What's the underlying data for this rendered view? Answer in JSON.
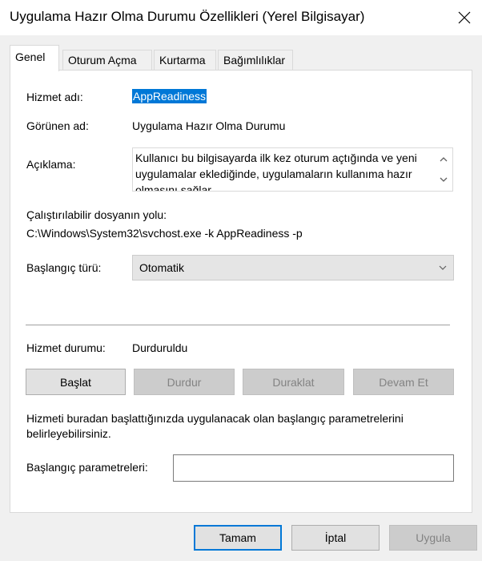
{
  "window": {
    "title": "Uygulama Hazır Olma Durumu Özellikleri (Yerel Bilgisayar)"
  },
  "tabs": [
    {
      "label": "Genel",
      "active": true
    },
    {
      "label": "Oturum Açma",
      "active": false
    },
    {
      "label": "Kurtarma",
      "active": false
    },
    {
      "label": "Bağımlılıklar",
      "active": false
    }
  ],
  "general": {
    "service_name_label": "Hizmet adı:",
    "service_name_value": "AppReadiness",
    "display_name_label": "Görünen ad:",
    "display_name_value": "Uygulama Hazır Olma Durumu",
    "description_label": "Açıklama:",
    "description_value": "Kullanıcı bu bilgisayarda ilk kez oturum açtığında ve yeni uygulamalar eklediğinde, uygulamaların kullanıma hazır olmasını sağlar.",
    "exe_path_label": "Çalıştırılabilir dosyanın yolu:",
    "exe_path_value": "C:\\Windows\\System32\\svchost.exe -k AppReadiness -p",
    "startup_type_label": "Başlangıç türü:",
    "startup_type_value": "Otomatik",
    "service_status_label": "Hizmet durumu:",
    "service_status_value": "Durduruldu",
    "buttons": {
      "start": "Başlat",
      "stop": "Durdur",
      "pause": "Duraklat",
      "resume": "Devam Et"
    },
    "hint_text": "Hizmeti buradan başlattığınızda uygulanacak olan başlangıç parametrelerini belirleyebilirsiniz.",
    "start_params_label": "Başlangıç parametreleri:",
    "start_params_value": ""
  },
  "footer": {
    "ok": "Tamam",
    "cancel": "İptal",
    "apply": "Uygula"
  },
  "colors": {
    "selection": "#0078d7",
    "accent_border": "#0078d7"
  },
  "icons": {
    "close": "close-icon",
    "scroll_up": "chevron-up-icon",
    "scroll_down": "chevron-down-icon",
    "dropdown": "chevron-down-icon"
  }
}
